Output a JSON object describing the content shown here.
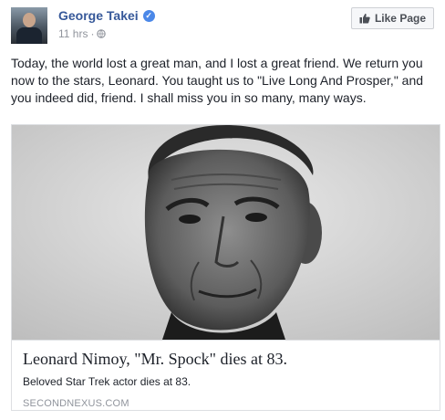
{
  "post": {
    "author": "George Takei",
    "timestamp": "11 hrs",
    "separator": "·",
    "like_page_label": "Like Page",
    "text": "Today, the world lost a great man, and I lost a great friend. We return you now to the stars, Leonard. You taught us to \"Live Long And Prosper,\" and you indeed did, friend. I shall miss you in so many, many ways."
  },
  "link_card": {
    "title": "Leonard Nimoy, \"Mr. Spock\" dies at 83.",
    "description": "Beloved Star Trek actor dies at 83.",
    "domain": "SECONDNEXUS.COM"
  },
  "icons": {
    "verified": "verified-badge-icon",
    "privacy": "globe-icon",
    "like": "thumbs-up-icon"
  },
  "colors": {
    "author_name": "#365899",
    "verified_badge": "#4b88e8",
    "meta_text": "#90949c",
    "body_text": "#1d2129"
  }
}
